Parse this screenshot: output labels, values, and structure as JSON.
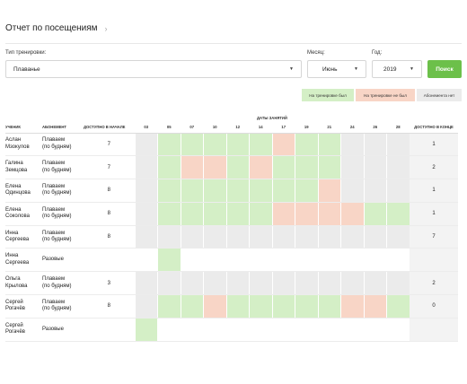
{
  "page": {
    "title": "Отчет по посещениям",
    "chevron": "›"
  },
  "filters": {
    "type_label": "Тип тренировки:",
    "type_value": "Плаванье",
    "month_label": "Месяц:",
    "month_value": "Июнь",
    "year_label": "Год:",
    "year_value": "2019",
    "search_button": "Поиск",
    "dropdown_arrow": "▼"
  },
  "legend": {
    "attended": "На тренировке был",
    "missed": "На тренировке не был",
    "no_pass": "Абонемента нет"
  },
  "colors": {
    "attended": "#d4efc6",
    "missed": "#f8d5c6",
    "no_pass": "#ebebeb",
    "accent": "#6cc04a"
  },
  "table": {
    "dates_header": "ДАТЫ ЗАНЯТИЙ",
    "col_student": "УЧЕНИК",
    "col_pass": "АБОНЕМЕНТ",
    "col_start": "ДОСТУПНО В НАЧАЛЕ",
    "col_end": "ДОСТУПНО В КОНЦЕ",
    "dates": [
      "03",
      "05",
      "07",
      "10",
      "12",
      "14",
      "17",
      "19",
      "21",
      "24",
      "26",
      "28"
    ],
    "rows": [
      {
        "name1": "Аслан",
        "name2": "Мзокулов",
        "pass1": "Плаваем",
        "pass2": "(по будням)",
        "start": "7",
        "end": "1",
        "cells": "ngggggpggnnn"
      },
      {
        "name1": "Галина",
        "name2": "Земцова",
        "pass1": "Плаваем",
        "pass2": "(по будням)",
        "start": "7",
        "end": "2",
        "cells": "ngppgpgggnnn"
      },
      {
        "name1": "Елена",
        "name2": "Одинцова",
        "pass1": "Плаваем",
        "pass2": "(по будням)",
        "start": "8",
        "end": "1",
        "cells": "ngggggggpnnn"
      },
      {
        "name1": "Елена",
        "name2": "Соколова",
        "pass1": "Плаваем",
        "pass2": "(по будням)",
        "start": "8",
        "end": "1",
        "cells": "ngggggppppgg"
      },
      {
        "name1": "Инна",
        "name2": "Сергеева",
        "pass1": "Плаваем",
        "pass2": "(по будням)",
        "start": "8",
        "end": "7",
        "cells": "nnnnnnnnnnnn"
      },
      {
        "name1": "Инна",
        "name2": "Сергеева",
        "pass1": "Разовые",
        "pass2": "",
        "start": "",
        "end": "",
        "cells": "_g__________"
      },
      {
        "name1": "Ольга",
        "name2": "Крылова",
        "pass1": "Плаваем",
        "pass2": "(по будням)",
        "start": "3",
        "end": "2",
        "cells": "nnnnnnnnnnnn"
      },
      {
        "name1": "Сергей",
        "name2": "Рогачёв",
        "pass1": "Плаваем",
        "pass2": "(по будням)",
        "start": "8",
        "end": "0",
        "cells": "nggpgggggppg"
      },
      {
        "name1": "Сергей",
        "name2": "Рогачёв",
        "pass1": "Разовые",
        "pass2": "",
        "start": "",
        "end": "",
        "cells": "g___________"
      }
    ]
  }
}
